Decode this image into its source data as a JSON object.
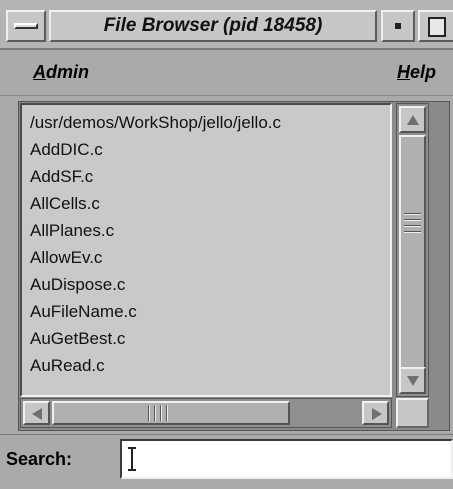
{
  "window": {
    "title": "File Browser (pid 18458)"
  },
  "menubar": {
    "admin_label": {
      "mnemonic": "A",
      "rest": "dmin"
    },
    "help_label": {
      "mnemonic": "H",
      "rest": "elp"
    }
  },
  "file_list": {
    "items": [
      "/usr/demos/WorkShop/jello/jello.c",
      "AddDIC.c",
      "AddSF.c",
      "AllCells.c",
      "AllPlanes.c",
      "AllowEv.c",
      "AuDispose.c",
      "AuFileName.c",
      "AuGetBest.c",
      "AuRead.c"
    ]
  },
  "search": {
    "label": "Search:",
    "value": ""
  },
  "icons": {
    "window_menu": "window-menu-icon",
    "minimize": "minimize-icon",
    "maximize": "maximize-icon",
    "scroll_up": "arrow-up-icon",
    "scroll_down": "arrow-down-icon",
    "scroll_left": "arrow-left-icon",
    "scroll_right": "arrow-right-icon",
    "text_cursor": "text-cursor-icon"
  },
  "colors": {
    "chrome": "#aaaaaa",
    "list_background": "#c9c9c9",
    "input_background": "#ffffff"
  }
}
